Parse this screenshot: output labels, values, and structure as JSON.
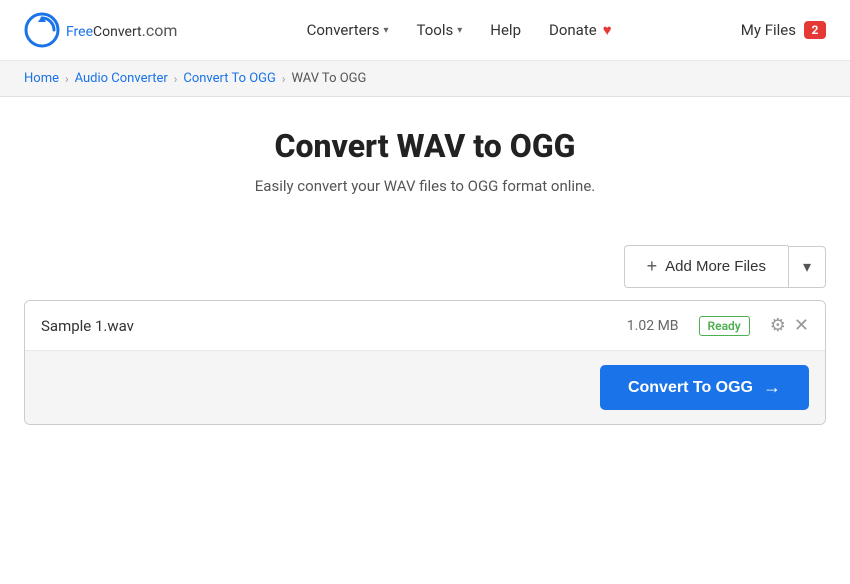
{
  "site": {
    "logo_free": "Free",
    "logo_convert": "Convert",
    "logo_domain": ".com"
  },
  "nav": {
    "converters_label": "Converters",
    "tools_label": "Tools",
    "help_label": "Help",
    "donate_label": "Donate",
    "my_files_label": "My Files",
    "my_files_count": "2"
  },
  "breadcrumb": {
    "home": "Home",
    "audio_converter": "Audio Converter",
    "convert_to_ogg": "Convert To OGG",
    "current": "WAV To OGG"
  },
  "page": {
    "title": "Convert WAV to OGG",
    "subtitle": "Easily convert your WAV files to OGG format online."
  },
  "toolbar": {
    "add_files_label": "Add More Files",
    "dropdown_icon": "▾"
  },
  "file_row": {
    "filename": "Sample 1.wav",
    "filesize": "1.02 MB",
    "status": "Ready"
  },
  "convert_btn": {
    "label": "Convert To OGG",
    "arrow": "→"
  }
}
